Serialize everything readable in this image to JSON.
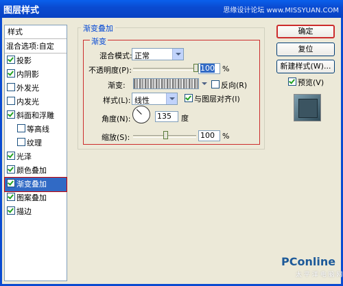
{
  "window": {
    "title": "图层样式",
    "watermark": "思缘设计论坛 www.MISSYUAN.COM"
  },
  "style_list": {
    "header": "样式",
    "blend_options": "混合选项:自定",
    "items": [
      {
        "label": "投影",
        "checked": true
      },
      {
        "label": "内阴影",
        "checked": true
      },
      {
        "label": "外发光",
        "checked": false
      },
      {
        "label": "内发光",
        "checked": false
      },
      {
        "label": "斜面和浮雕",
        "checked": true
      },
      {
        "label": "等高线",
        "checked": false
      },
      {
        "label": "纹理",
        "checked": false
      },
      {
        "label": "光泽",
        "checked": true
      },
      {
        "label": "颜色叠加",
        "checked": true
      },
      {
        "label": "渐变叠加",
        "checked": true,
        "selected": true
      },
      {
        "label": "图案叠加",
        "checked": true
      },
      {
        "label": "描边",
        "checked": true
      }
    ]
  },
  "panel": {
    "group_title": "渐变叠加",
    "subgroup_title": "渐变",
    "blend_mode_label": "混合模式:",
    "blend_mode_value": "正常",
    "opacity_label": "不透明度(P):",
    "opacity_value": "100",
    "opacity_unit": "%",
    "opacity_level": 1.0,
    "gradient_label": "渐变:",
    "reverse_label": "反向(R)",
    "reverse_checked": false,
    "style_label": "样式(L):",
    "style_value": "线性",
    "align_label": "与图层对齐(I)",
    "align_checked": true,
    "angle_label": "角度(N):",
    "angle_value": "135",
    "angle_unit": "度",
    "scale_label": "缩放(S):",
    "scale_value": "100",
    "scale_unit": "%",
    "scale_level": 0.5
  },
  "buttons": {
    "ok": "确定",
    "reset": "复位",
    "new_style": "新建样式(W)...",
    "preview": "预览(V)",
    "preview_checked": true
  },
  "logo": {
    "text": "PConline",
    "sub": "太 平 洋 电 脑 网"
  }
}
